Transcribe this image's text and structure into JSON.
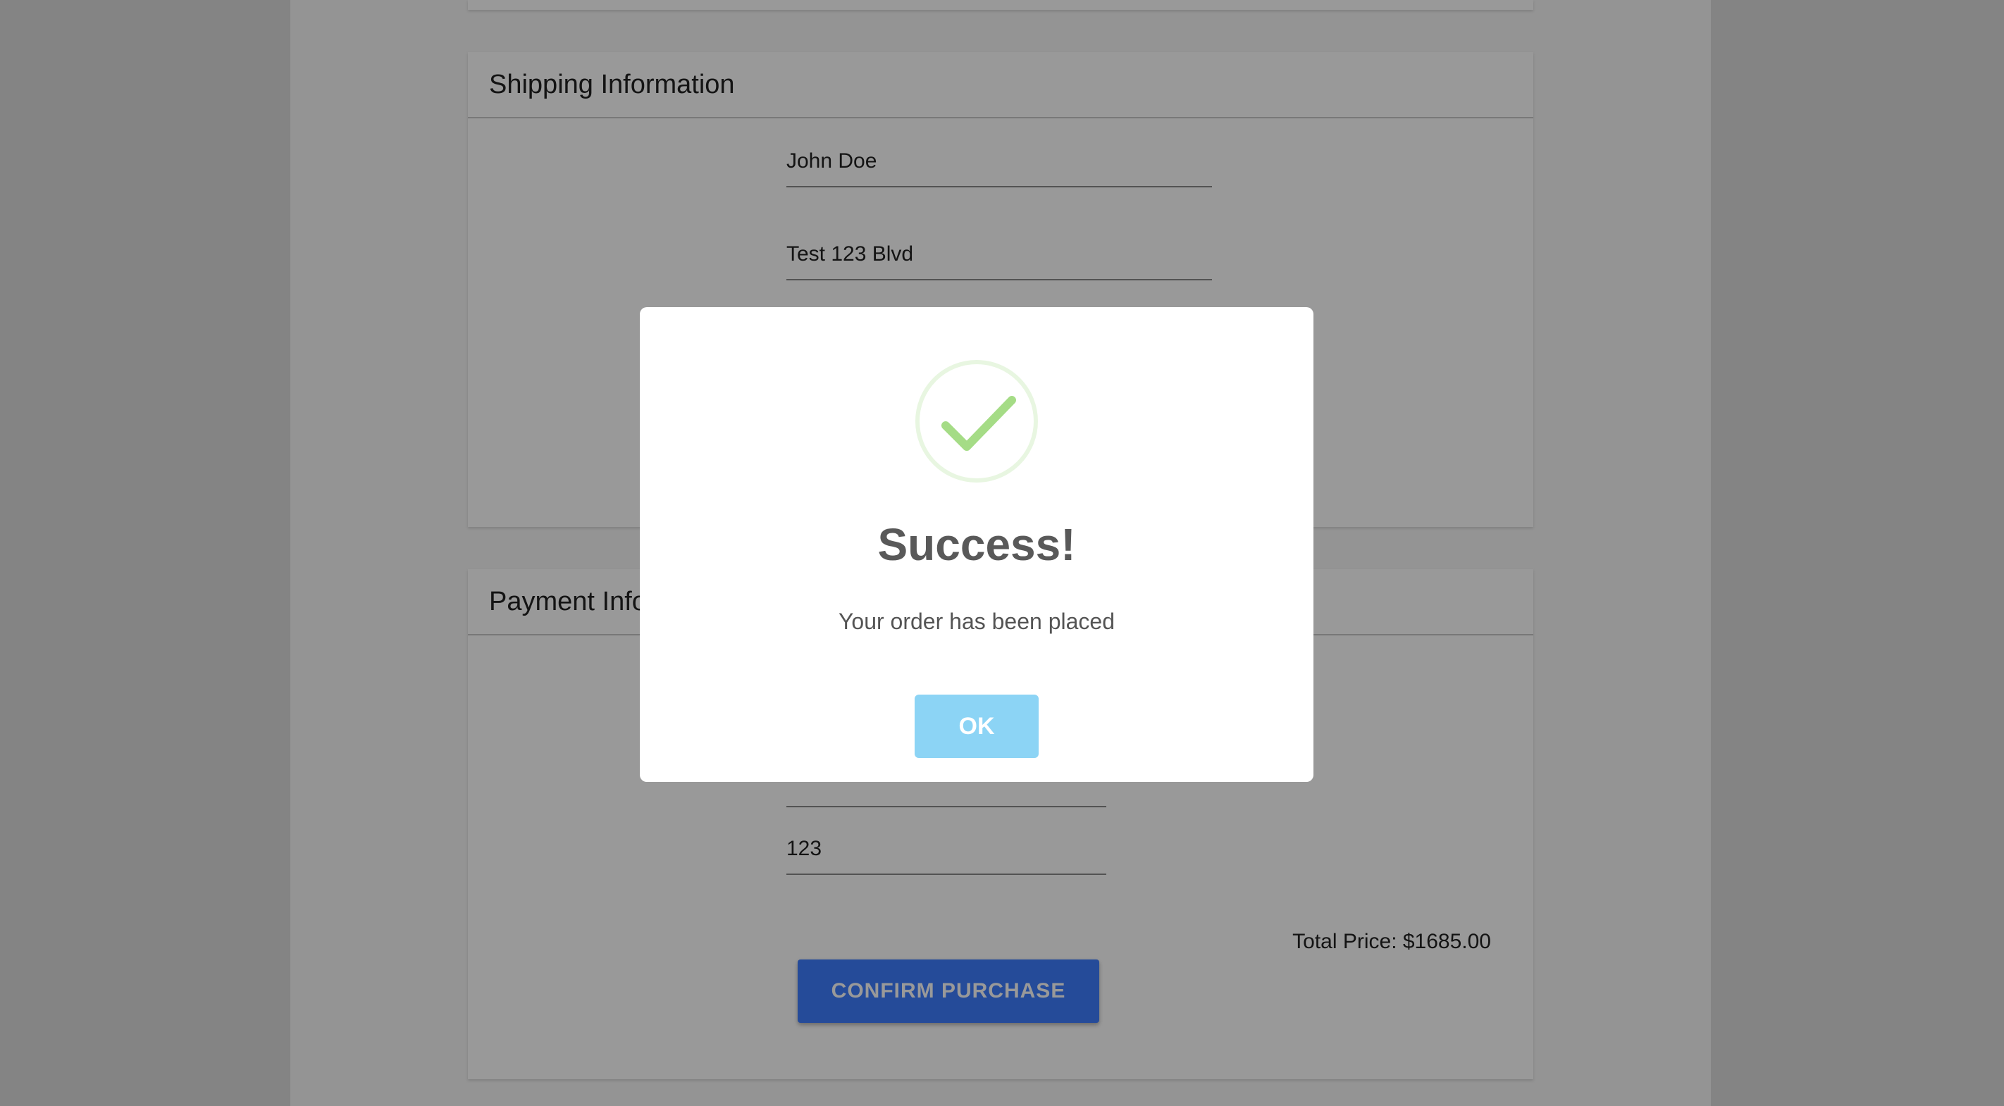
{
  "shipping": {
    "title": "Shipping Information",
    "name_value": "John Doe",
    "address_value": "Test 123 Blvd"
  },
  "payment": {
    "title": "Payment Information",
    "cvv_value": "123",
    "total_price": "Total Price: $1685.00",
    "confirm_label": "CONFIRM PURCHASE"
  },
  "modal": {
    "icon": "success-check-icon",
    "title": "Success!",
    "message": "Your order has been placed",
    "ok_label": "OK"
  },
  "colors": {
    "success_green": "#a5dc86",
    "ok_button": "#8cd4f5",
    "confirm_button": "#3f7dff"
  }
}
